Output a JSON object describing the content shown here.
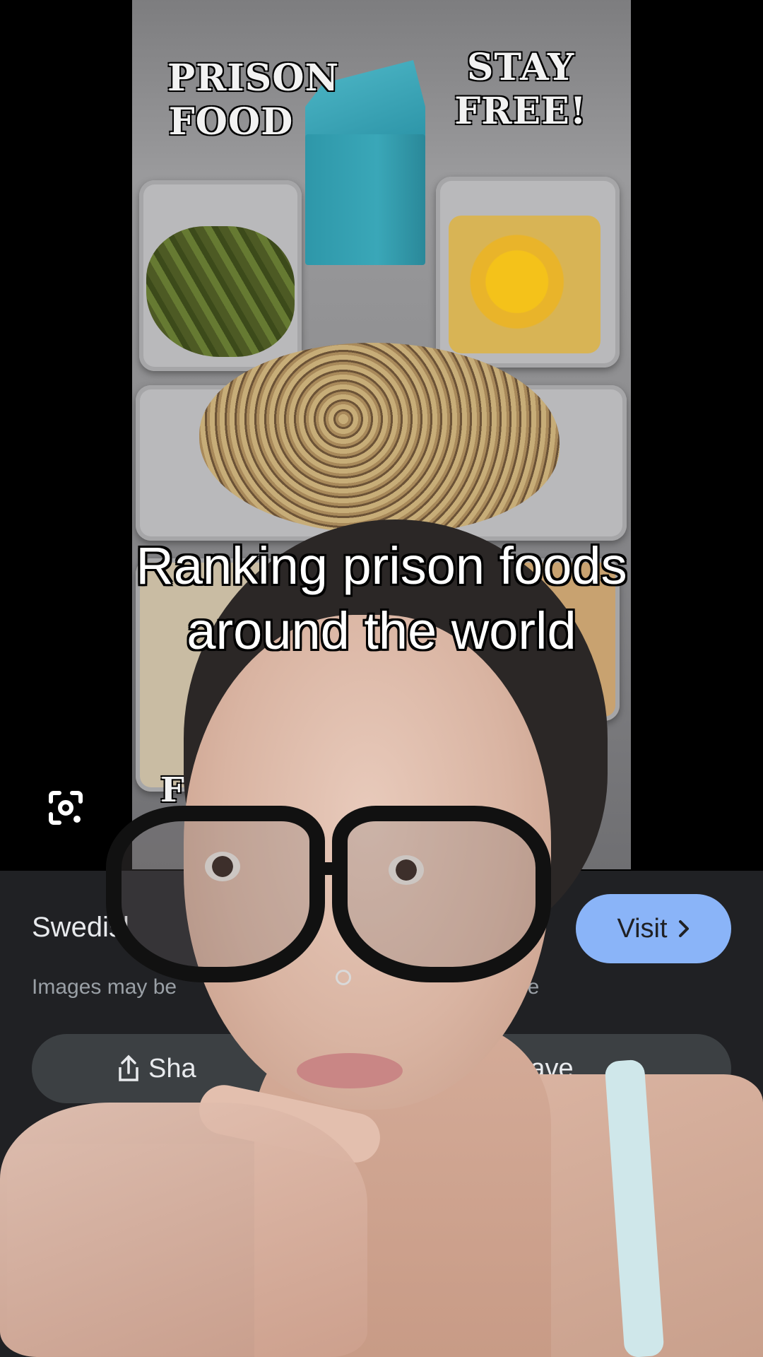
{
  "viewer": {
    "photo_text": {
      "prison_food": "PRISON\nFOOD",
      "stay_free": "STAY\nFREE!",
      "partial_letter": "F"
    },
    "lens_icon": "google-lens-icon"
  },
  "panel": {
    "title": "Swedisl",
    "subtitle_left": "Images may be",
    "subtitle_right": "ore",
    "visit_label": "Visit",
    "share_label": "Sha",
    "save_label": "Save"
  },
  "caption": {
    "line1": "Ranking prison foods",
    "line2": "around the world"
  },
  "colors": {
    "panel_bg": "#202124",
    "visit_button": "#8ab4f8",
    "pill_bg": "#3c4043"
  }
}
